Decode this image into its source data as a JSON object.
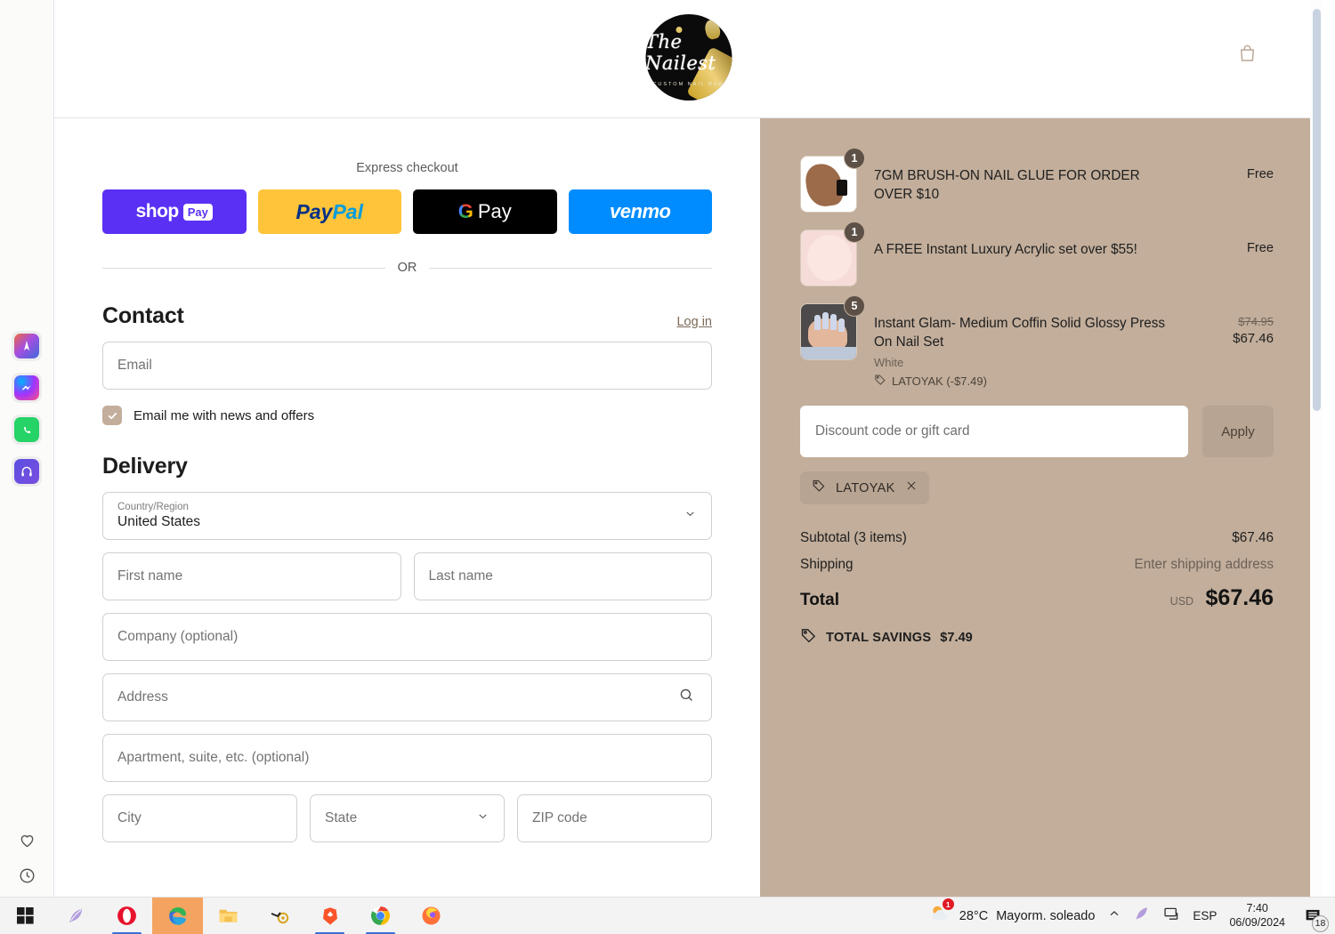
{
  "browser": {
    "sidebar": {
      "apps": [
        {
          "name": "ai-assistant-icon",
          "label": "AI"
        },
        {
          "name": "messenger-icon",
          "label": "Messenger"
        },
        {
          "name": "whatsapp-icon",
          "label": "WhatsApp"
        },
        {
          "name": "headphones-icon",
          "label": "Audio"
        }
      ],
      "bottom": [
        {
          "name": "favorites-heart-icon",
          "label": "Favorites"
        },
        {
          "name": "history-clock-icon",
          "label": "History"
        }
      ]
    }
  },
  "header": {
    "logo_word": "The Nailest",
    "logo_sub": "CUSTOM NAIL BAR",
    "bag_icon": "shopping-bag-icon"
  },
  "express": {
    "label": "Express checkout",
    "buttons": [
      {
        "name": "shop-pay-button",
        "word": "shop",
        "tag": "Pay",
        "color": "#5a31f4"
      },
      {
        "name": "paypal-button",
        "word1": "Pay",
        "word2": "Pal",
        "color": "#ffc439"
      },
      {
        "name": "google-pay-button",
        "g": "G",
        "word": "Pay",
        "color": "#000000"
      },
      {
        "name": "venmo-button",
        "word": "venmo",
        "color": "#008cff"
      }
    ],
    "divider_text": "OR"
  },
  "contact": {
    "title": "Contact",
    "login_label": "Log in",
    "email_placeholder": "Email",
    "email_value": "",
    "newsletter_label": "Email me with news and offers",
    "newsletter_checked": true
  },
  "delivery": {
    "title": "Delivery",
    "country_label": "Country/Region",
    "country_value": "United States",
    "first_name_placeholder": "First name",
    "last_name_placeholder": "Last name",
    "company_placeholder": "Company (optional)",
    "address_placeholder": "Address",
    "apartment_placeholder": "Apartment, suite, etc. (optional)",
    "city_placeholder": "City",
    "state_placeholder": "State",
    "zip_placeholder": "ZIP code"
  },
  "summary": {
    "items": [
      {
        "name": "7GM BRUSH-ON NAIL GLUE FOR ORDER OVER $10",
        "qty": "1",
        "variant": "",
        "discount": "",
        "price": "Free",
        "old_price": "",
        "thumb": "nail-glue-thumbnail"
      },
      {
        "name": "A FREE Instant Luxury Acrylic set over $55!",
        "qty": "1",
        "variant": "",
        "discount": "",
        "price": "Free",
        "old_price": "",
        "thumb": "acrylic-set-thumbnail"
      },
      {
        "name": "Instant Glam- Medium Coffin Solid Glossy Press On Nail Set",
        "qty": "5",
        "variant": "White",
        "discount": "LATOYAK (-$7.49)",
        "price": "$67.46",
        "old_price": "$74.95",
        "thumb": "press-on-nails-thumbnail"
      }
    ],
    "discount_placeholder": "Discount code or gift card",
    "discount_value": "",
    "apply_label": "Apply",
    "applied_code": "LATOYAK",
    "subtotal_label": "Subtotal (3 items)",
    "subtotal_value": "$67.46",
    "shipping_label": "Shipping",
    "shipping_value": "Enter shipping address",
    "total_label": "Total",
    "total_currency": "USD",
    "total_value": "$67.46",
    "savings_label": "TOTAL SAVINGS",
    "savings_value": "$7.49"
  },
  "taskbar": {
    "apps": [
      {
        "name": "start-button",
        "label": "Start"
      },
      {
        "name": "search-feather-icon",
        "label": "Search"
      },
      {
        "name": "opera-taskbar-icon",
        "label": "Opera"
      },
      {
        "name": "edge-taskbar-icon",
        "label": "Microsoft Edge"
      },
      {
        "name": "file-explorer-taskbar-icon",
        "label": "File Explorer"
      },
      {
        "name": "tool-taskbar-icon",
        "label": "Tool"
      },
      {
        "name": "brave-taskbar-icon",
        "label": "Brave"
      },
      {
        "name": "chrome-taskbar-icon",
        "label": "Chrome"
      },
      {
        "name": "firefox-taskbar-icon",
        "label": "Firefox"
      }
    ],
    "weather_temp": "28°C",
    "weather_desc": "Mayorm. soleado",
    "weather_badge": "1",
    "language": "ESP",
    "time": "7:40",
    "date": "06/09/2024",
    "notification_count": "18"
  },
  "colors": {
    "summary_bg": "#c2ae9b",
    "accent": "#5a31f4",
    "checkbox": "#c2ae9b"
  }
}
